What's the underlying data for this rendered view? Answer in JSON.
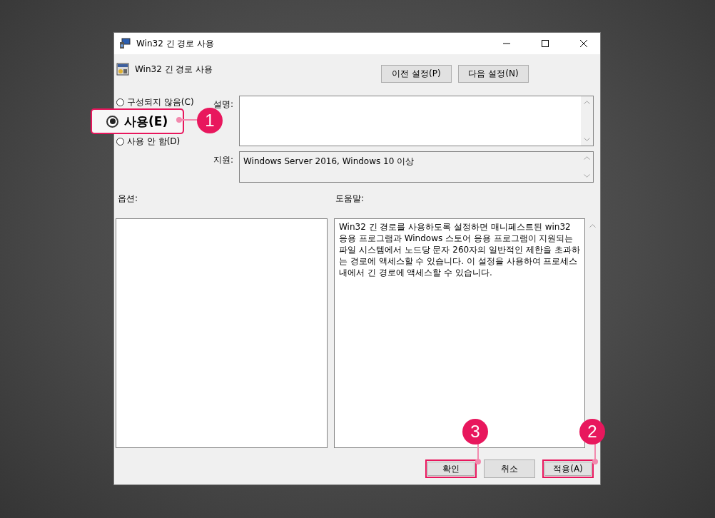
{
  "window": {
    "title": "Win32 긴 경로 사용"
  },
  "policy": {
    "title": "Win32 긴 경로 사용"
  },
  "nav_buttons": [
    "이전 설정(P)",
    "다음 설정(N)"
  ],
  "states": [
    {
      "label": "구성되지 않음(C)",
      "selected": false
    },
    {
      "label": "사용(E)",
      "selected": true,
      "callout": "1"
    },
    {
      "label": "사용 안 함(D)",
      "selected": false
    }
  ],
  "comment": {
    "label": "설명:"
  },
  "supported": {
    "label": "지원:",
    "value": "Windows Server 2016, Windows 10 이상"
  },
  "options": {
    "label": "옵션:"
  },
  "help": {
    "label": "도움말:",
    "text": "Win32 긴 경로를 사용하도록 설정하면 매니페스트된 win32 응용 프로그램과 Windows 스토어 응용 프로그램이 지원되는 파일 시스템에서 노드당 문자 260자의 일반적인 제한을 초과하는 경로에 액세스할 수 있습니다. 이 설정을 사용하여 프로세스 내에서 긴 경로에 액세스할 수 있습니다."
  },
  "buttons": [
    {
      "label": "확인",
      "callout": "3"
    },
    {
      "label": "취소"
    },
    {
      "label": "적용(A)",
      "callout": "2"
    }
  ]
}
